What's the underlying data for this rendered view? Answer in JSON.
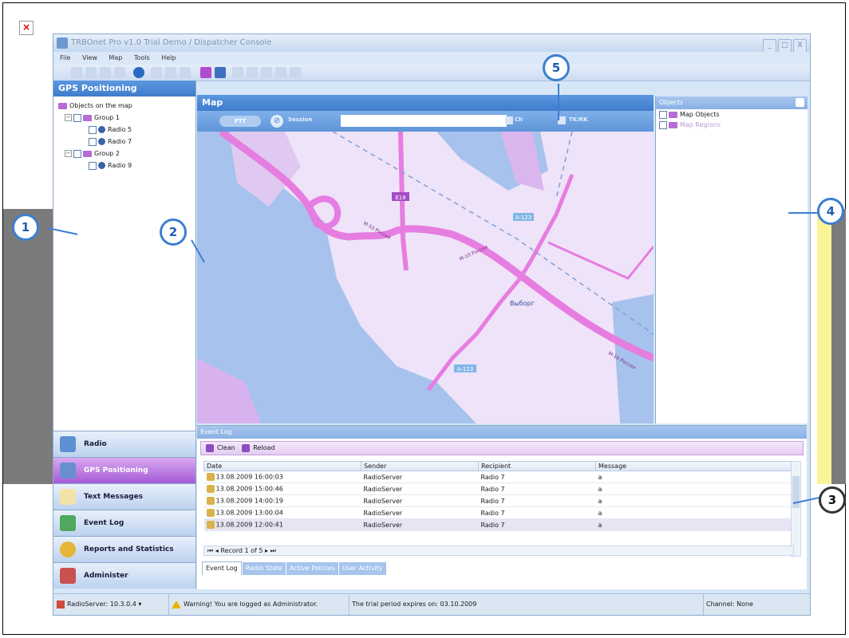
{
  "window": {
    "title": "TRBOnet Pro v1.0 Trial Demo / Dispatcher Console",
    "minimize": "_",
    "maximize": "□",
    "close": "X"
  },
  "menu": [
    "File",
    "View",
    "Map",
    "Tools",
    "Help"
  ],
  "gps_panel": {
    "title": "GPS Positioning",
    "tree": [
      {
        "label": "Objects on the map",
        "level": 0
      },
      {
        "label": "Group 1",
        "level": 1
      },
      {
        "label": "Radio 5",
        "level": 2
      },
      {
        "label": "Radio 7",
        "level": 2
      },
      {
        "label": "Group 2",
        "level": 1
      },
      {
        "label": "Radio 9",
        "level": 2
      }
    ]
  },
  "nav": [
    {
      "label": "Radio",
      "active": false
    },
    {
      "label": "GPS Positioning",
      "active": true
    },
    {
      "label": "Text Messages",
      "active": false
    },
    {
      "label": "Event Log",
      "active": false
    },
    {
      "label": "Reports and Statistics",
      "active": false
    },
    {
      "label": "Administer",
      "active": false
    }
  ],
  "map": {
    "title": "Map",
    "ptt_label": "PTT",
    "session_label": "Session",
    "session_value": "",
    "ch_label": "Ch",
    "tkrk_label": "TK/RK",
    "labels": {
      "city": "Выборг",
      "e18": "E18",
      "a123a": "A-123",
      "a123b": "A-123",
      "m10a": "M-10 Россия",
      "m10b": "M-10 Россия",
      "m10c": "M-10 Россия"
    }
  },
  "objects_panel": {
    "title": "Objects",
    "items": [
      "Map Objects",
      "Map Regions"
    ]
  },
  "event_log": {
    "title": "Event Log",
    "clean_label": "Clean",
    "reload_label": "Reload",
    "columns": [
      "Date",
      "Sender",
      "Recipient",
      "Message"
    ],
    "rows": [
      [
        "13.08.2009 16:00:03",
        "RadioServer",
        "Radio 7",
        "a"
      ],
      [
        "13.08.2009 15:00:46",
        "RadioServer",
        "Radio 7",
        "a"
      ],
      [
        "13.08.2009 14:00:19",
        "RadioServer",
        "Radio 7",
        "a"
      ],
      [
        "13.08.2009 13:00:04",
        "RadioServer",
        "Radio 7",
        "a"
      ],
      [
        "13.08.2009 12:00:41",
        "RadioServer",
        "Radio 7",
        "a"
      ]
    ],
    "pager": "Record 1 of 5",
    "tabs": [
      "Event Log",
      "Radio State",
      "Active Policies",
      "User Activity"
    ]
  },
  "status_bar": {
    "server": "RadioServer: 10.3.0.4",
    "warning": "Warning! You are logged as Administrator.",
    "trial": "The trial period expires on: 03.10.2009",
    "channel": "Channel: None"
  },
  "callouts": [
    "1",
    "2",
    "3",
    "4",
    "5"
  ],
  "colors": {
    "accent": "#3f7ccb",
    "map_water": "#a7c2ec",
    "map_land": "#efe3f9",
    "map_road": "#e67de0",
    "nav_active": "#a55ad6"
  }
}
